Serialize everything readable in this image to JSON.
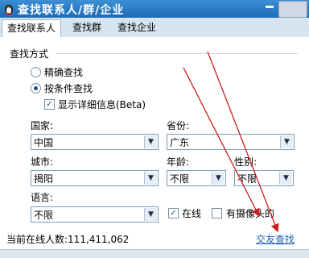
{
  "window": {
    "title": "查找联系人/群/企业"
  },
  "tabs": [
    "查找联系人",
    "查找群",
    "查找企业"
  ],
  "search_mode": {
    "heading": "查找方式",
    "exact": "精确查找",
    "conditional": "按条件查找",
    "show_detail": "显示详细信息(Beta)"
  },
  "fields": {
    "country_label": "国家:",
    "country_value": "中国",
    "province_label": "省份:",
    "province_value": "广东",
    "city_label": "城市:",
    "city_value": "揭阳",
    "age_label": "年龄:",
    "age_value": "不限",
    "gender_label": "性别:",
    "gender_value": "不限",
    "language_label": "语言:",
    "language_value": "不限",
    "online_label": "在线",
    "webcam_label": "有摄像头的"
  },
  "status": {
    "online_count": "当前在线人数:111,411,062",
    "friend_search": "交友查找"
  },
  "annotation_color": "#cc1f1f"
}
